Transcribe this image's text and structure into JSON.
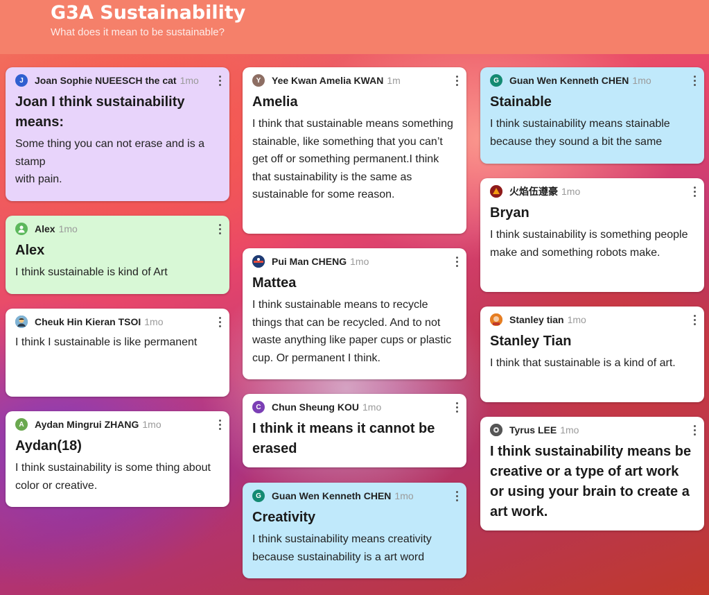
{
  "header": {
    "title": "G3A Sustainability",
    "subtitle": "What does it mean to be sustainable?"
  },
  "posts": [
    {
      "author": "Joan Sophie NUEESCH the cat",
      "time": "1mo",
      "avatar": "J",
      "avatar_color": "#2f5fd0",
      "title": "Joan I think sustainability means:",
      "body": "Some thing you can not erase and is a stamp\nwith pain.",
      "bg": "#e8d4fb"
    },
    {
      "author": "Alex",
      "time": "1mo",
      "avatar": "",
      "avatar_color": "#5cb85c",
      "title": "Alex",
      "body": "I think sustainable is kind of Art",
      "bg": "#d8f8d6"
    },
    {
      "author": "Cheuk Hin Kieran TSOI",
      "time": "1mo",
      "avatar": "",
      "avatar_color": "#3a6e8f",
      "title": "",
      "body": "I think I  sustainable is like permanent",
      "bg": "#ffffff"
    },
    {
      "author": "Aydan Mingrui ZHANG",
      "time": "1mo",
      "avatar": "A",
      "avatar_color": "#6aa84f",
      "title": "Aydan(18)",
      "body": "I think sustainability is some thing about color or creative.",
      "bg": "#ffffff"
    },
    {
      "author": "Yee Kwan Amelia KWAN",
      "time": "1m",
      "avatar": "Y",
      "avatar_color": "#8d6e63",
      "title": "Amelia",
      "body": "I think that sustainable means something stainable, like something that you can’t get off or something permanent.I think that sustainability is the same as sustainable for some reason.",
      "bg": "#ffffff"
    },
    {
      "author": "Pui Man CHENG",
      "time": "1mo",
      "avatar": "",
      "avatar_color": "#1f3b73",
      "title": "Mattea",
      "body": "I think sustainable means to recycle things that can be recycled. And to not waste anything like paper cups or plastic cup. Or permanent I think.",
      "bg": "#ffffff"
    },
    {
      "author": "Chun Sheung KOU",
      "time": "1mo",
      "avatar": "C",
      "avatar_color": "#7b3fb5",
      "title": "I think it means it cannot be erased",
      "body": "",
      "bg": "#ffffff"
    },
    {
      "author": "Guan Wen Kenneth CHEN",
      "time": "1mo",
      "avatar": "G",
      "avatar_color": "#138a72",
      "title": "Creativity",
      "body": "I think sustainability means creativity because sustainability is a art word",
      "bg": "#c0e9fb"
    },
    {
      "author": "Guan Wen Kenneth CHEN",
      "time": "1mo",
      "avatar": "G",
      "avatar_color": "#138a72",
      "title": "Stainable",
      "body": "I think sustainability means stainable because they sound a bit the same",
      "bg": "#c0e9fb"
    },
    {
      "author": "火焰伍遵豪",
      "time": "1mo",
      "avatar": "",
      "avatar_color": "#c0392b",
      "title": "Bryan",
      "body": "I think sustainability is something people make and something robots make.",
      "bg": "#ffffff"
    },
    {
      "author": "Stanley tian",
      "time": "1mo",
      "avatar": "",
      "avatar_color": "#d35400",
      "title": "Stanley Tian",
      "body": "I think that sustainable is a kind of art.",
      "bg": "#ffffff"
    },
    {
      "author": "Tyrus LEE",
      "time": "1mo",
      "avatar": "",
      "avatar_color": "#444444",
      "title": "I think sustainability means be creative or a type of art work or using your brain to create a art work.",
      "body": "",
      "bg": "#ffffff"
    }
  ]
}
